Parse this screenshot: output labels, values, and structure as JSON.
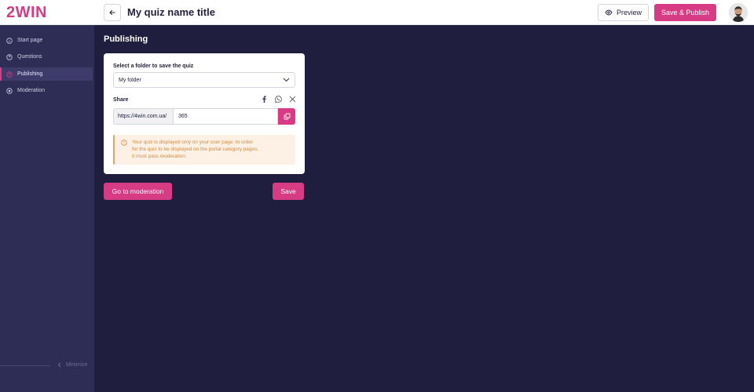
{
  "app": {
    "logo": "2WIN",
    "title": "My quiz name title"
  },
  "header": {
    "preview_label": "Preview",
    "publish_label": "Save & Publish"
  },
  "sidebar": {
    "items": [
      {
        "label": "Start page",
        "icon": "info-icon",
        "active": false
      },
      {
        "label": "Questions",
        "icon": "question-icon",
        "active": false
      },
      {
        "label": "Publishing",
        "icon": "publish-icon",
        "active": true
      },
      {
        "label": "Moderation",
        "icon": "moderation-icon",
        "active": false
      }
    ],
    "minimize_label": "Minimize"
  },
  "main": {
    "section_title": "Publishing",
    "folder": {
      "label": "Select a folder to save the quiz",
      "selected": "My folder"
    },
    "share": {
      "label": "Share",
      "icons": [
        "facebook-icon",
        "whatsapp-icon",
        "x-icon"
      ],
      "url_prefix": "https://4win.com.ua/",
      "url_value": "365"
    },
    "notice": {
      "lines": [
        "Your quiz is displayed only on your user page. In order",
        "for the quiz to be displayed on the portal category pages,",
        "it must pass moderation."
      ]
    },
    "moderation_label": "Go to moderation",
    "save_label": "Save"
  },
  "colors": {
    "accent": "#d63b83",
    "sidebar_bg": "#2e2d55",
    "main_bg": "#1f1e3e",
    "notice_bg": "#fdf1e6",
    "notice_text": "#d8893c"
  }
}
